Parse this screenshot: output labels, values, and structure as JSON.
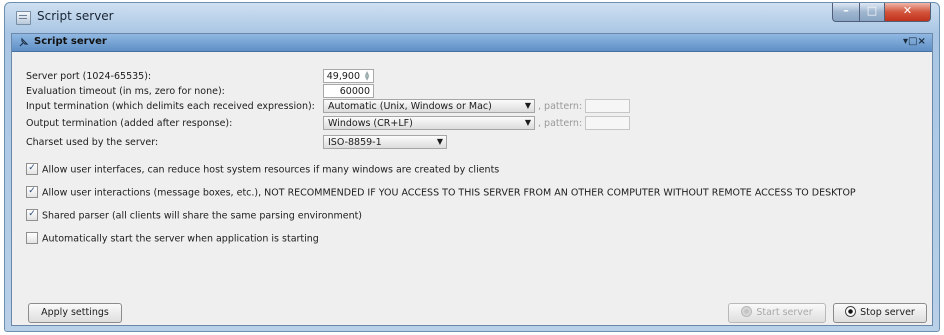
{
  "window": {
    "title": "Script server"
  },
  "panel": {
    "title": "Script server",
    "controls": "▾□×"
  },
  "fields": {
    "server_port_label": "Server port (1024-65535):",
    "server_port_value": "49,900",
    "eval_timeout_label": "Evaluation timeout (in ms, zero for none):",
    "eval_timeout_value": "60000",
    "input_term_label": "Input termination (which delimits each received expression):",
    "input_term_value": "Automatic (Unix, Windows or Mac)",
    "output_term_label": "Output termination (added after response):",
    "output_term_value": "Windows (CR+LF)",
    "charset_label": "Charset used by the server:",
    "charset_value": "ISO-8859-1",
    "pattern_label": ", pattern:"
  },
  "checkboxes": [
    {
      "label": "Allow user interfaces, can reduce host system resources if many windows are created by clients",
      "checked": true
    },
    {
      "label": "Allow user interactions (message boxes, etc.), NOT RECOMMENDED IF YOU ACCESS TO THIS SERVER FROM AN OTHER COMPUTER WITHOUT REMOTE ACCESS TO DESKTOP",
      "checked": true
    },
    {
      "label": "Shared parser (all clients will share the same parsing environment)",
      "checked": true
    },
    {
      "label": "Automatically start the server when application is starting",
      "checked": false
    }
  ],
  "buttons": {
    "apply": "Apply settings",
    "start": "Start server",
    "stop": "Stop server"
  },
  "check_mark": "✓"
}
